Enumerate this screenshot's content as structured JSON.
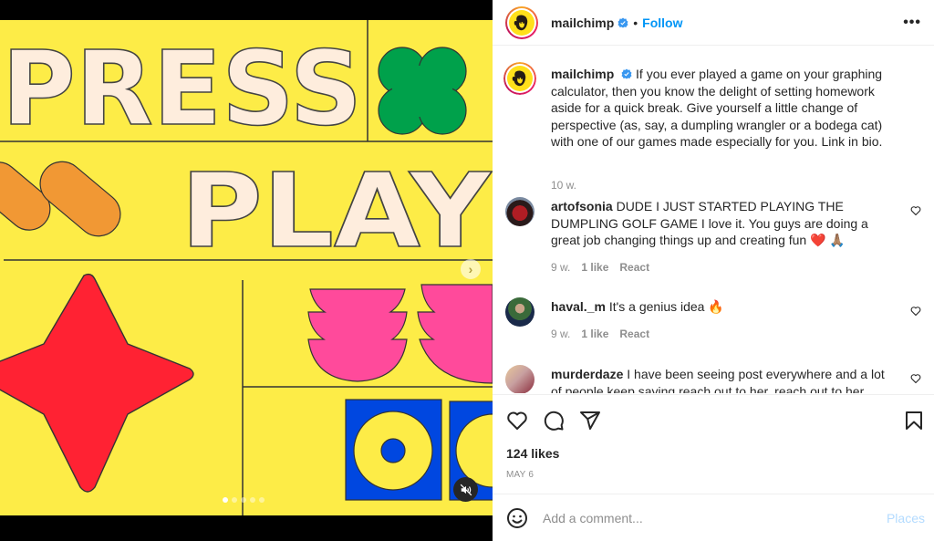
{
  "post": {
    "username": "mailchimp",
    "verified": true,
    "follow_label": "Follow",
    "separator": "•",
    "more_label": "•••",
    "media": {
      "headline_words": [
        "PRESS",
        "PLAY"
      ],
      "carousel_count": 5,
      "carousel_active": 0,
      "next_label": "›",
      "mute_icon": "speaker-muted-icon",
      "colors": {
        "background": "#fdec47",
        "letters": "#feeddd",
        "clover": "#00a14b",
        "pills": "#f19834",
        "star": "#ff2233",
        "bowls": "#ff4a9b",
        "tiles": "#0047e0"
      }
    }
  },
  "caption": {
    "username": "mailchimp",
    "text": "If you ever played a game on your graphing calculator, then you know the delight of setting homework aside for a quick break. Give yourself a little change of perspective (as, say, a dumpling wrangler or a bodega cat) with one of our games made especially for you. Link in bio.",
    "time": "10 w."
  },
  "comments": [
    {
      "username": "artofsonia",
      "text": "DUDE I JUST STARTED PLAYING THE DUMPLING GOLF GAME I love it. You guys are doing a great job changing things up and creating fun ❤️ 🙏🏽",
      "time": "9 w.",
      "likes": "1 like",
      "react": "React"
    },
    {
      "username": "haval._m",
      "text": "It's a genius idea 🔥",
      "time": "9 w.",
      "likes": "1 like",
      "react": "React"
    },
    {
      "username": "murderdaze",
      "text": "I have been seeing post everywhere and a lot of people keep saying reach out to her, reach out to her Decided"
    }
  ],
  "actions": {
    "like_icon": "heart-icon",
    "comment_icon": "comment-icon",
    "share_icon": "paper-plane-icon",
    "save_icon": "bookmark-icon"
  },
  "likes_count": "124 likes",
  "date": "MAY 6",
  "add_comment": {
    "placeholder": "Add a comment...",
    "post_label": "Places",
    "emoji_icon": "smiley-icon"
  }
}
